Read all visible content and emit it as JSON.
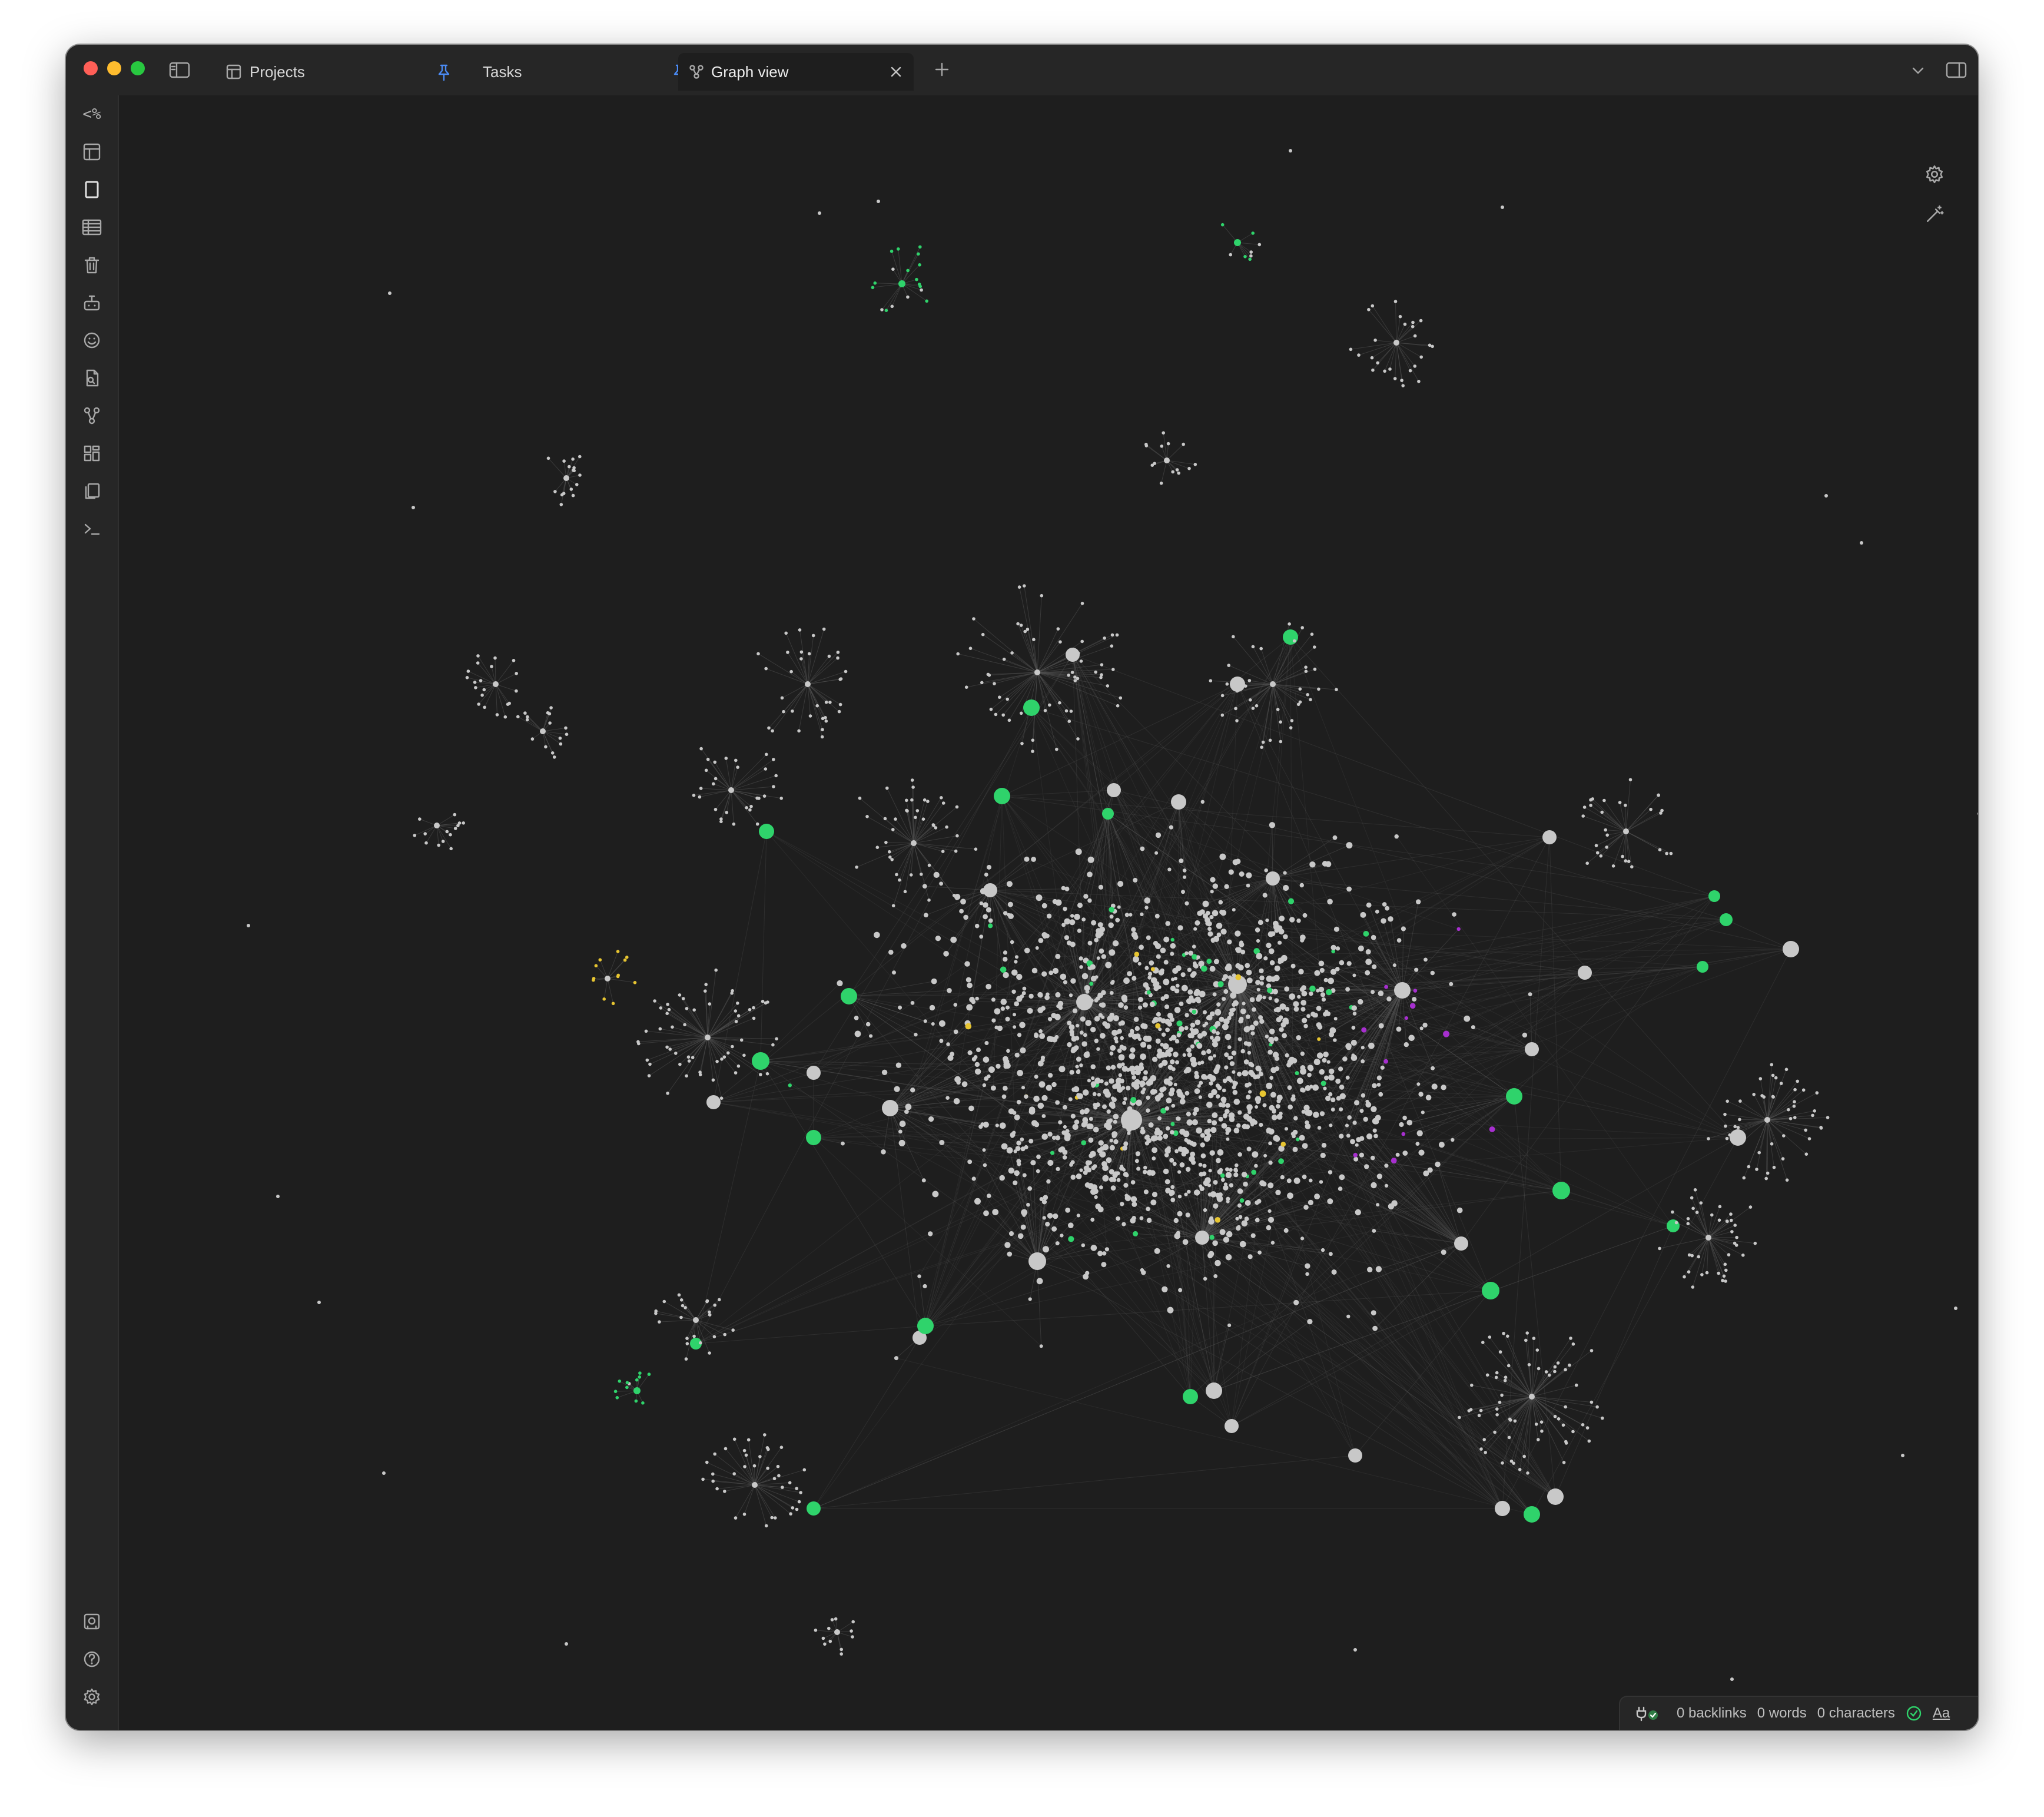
{
  "window": {
    "traffic_lights": {
      "close": "#ff5f57",
      "minimize": "#febc2e",
      "zoom": "#28c840"
    }
  },
  "tabs": [
    {
      "label": "Projects",
      "icon": "layout-icon",
      "pinned": true
    },
    {
      "label": "Tasks",
      "icon": "none",
      "pinned": true
    },
    {
      "label": "Graph view",
      "icon": "graph-icon",
      "active": true
    }
  ],
  "titlebar_icons": {
    "sidebar_toggle": "sidebar-toggle-icon",
    "new_tab": "plus-icon",
    "tab_list": "chevron-down-icon",
    "right_sidebar": "right-sidebar-icon"
  },
  "ribbon": {
    "top": [
      {
        "name": "templater-icon",
        "label": "<%"
      },
      {
        "name": "layout-icon"
      },
      {
        "name": "page-icon"
      },
      {
        "name": "table-icon"
      },
      {
        "name": "trash-icon"
      },
      {
        "name": "bot-icon"
      },
      {
        "name": "smiley-icon"
      },
      {
        "name": "file-search-icon"
      },
      {
        "name": "graph-icon"
      },
      {
        "name": "grid-icon"
      },
      {
        "name": "copy-icon"
      },
      {
        "name": "terminal-icon"
      }
    ],
    "bottom": [
      {
        "name": "vault-icon"
      },
      {
        "name": "help-icon"
      },
      {
        "name": "settings-icon"
      }
    ]
  },
  "graph_controls": [
    {
      "name": "graph-settings-icon"
    },
    {
      "name": "animate-wand-icon"
    }
  ],
  "graph": {
    "background": "#1e1e1e",
    "node_colors": {
      "default": "#c8c8c8",
      "green": "#2fd36b",
      "yellow": "#e7c531",
      "purple": "#a72fcf"
    },
    "edge_color": "#555555"
  },
  "status_bar": {
    "plugin_icon": "plug-check-icon",
    "backlinks": "0 backlinks",
    "words": "0 words",
    "characters": "0 characters",
    "sync_icon": "sync-check-icon",
    "font_label": "Aa"
  }
}
